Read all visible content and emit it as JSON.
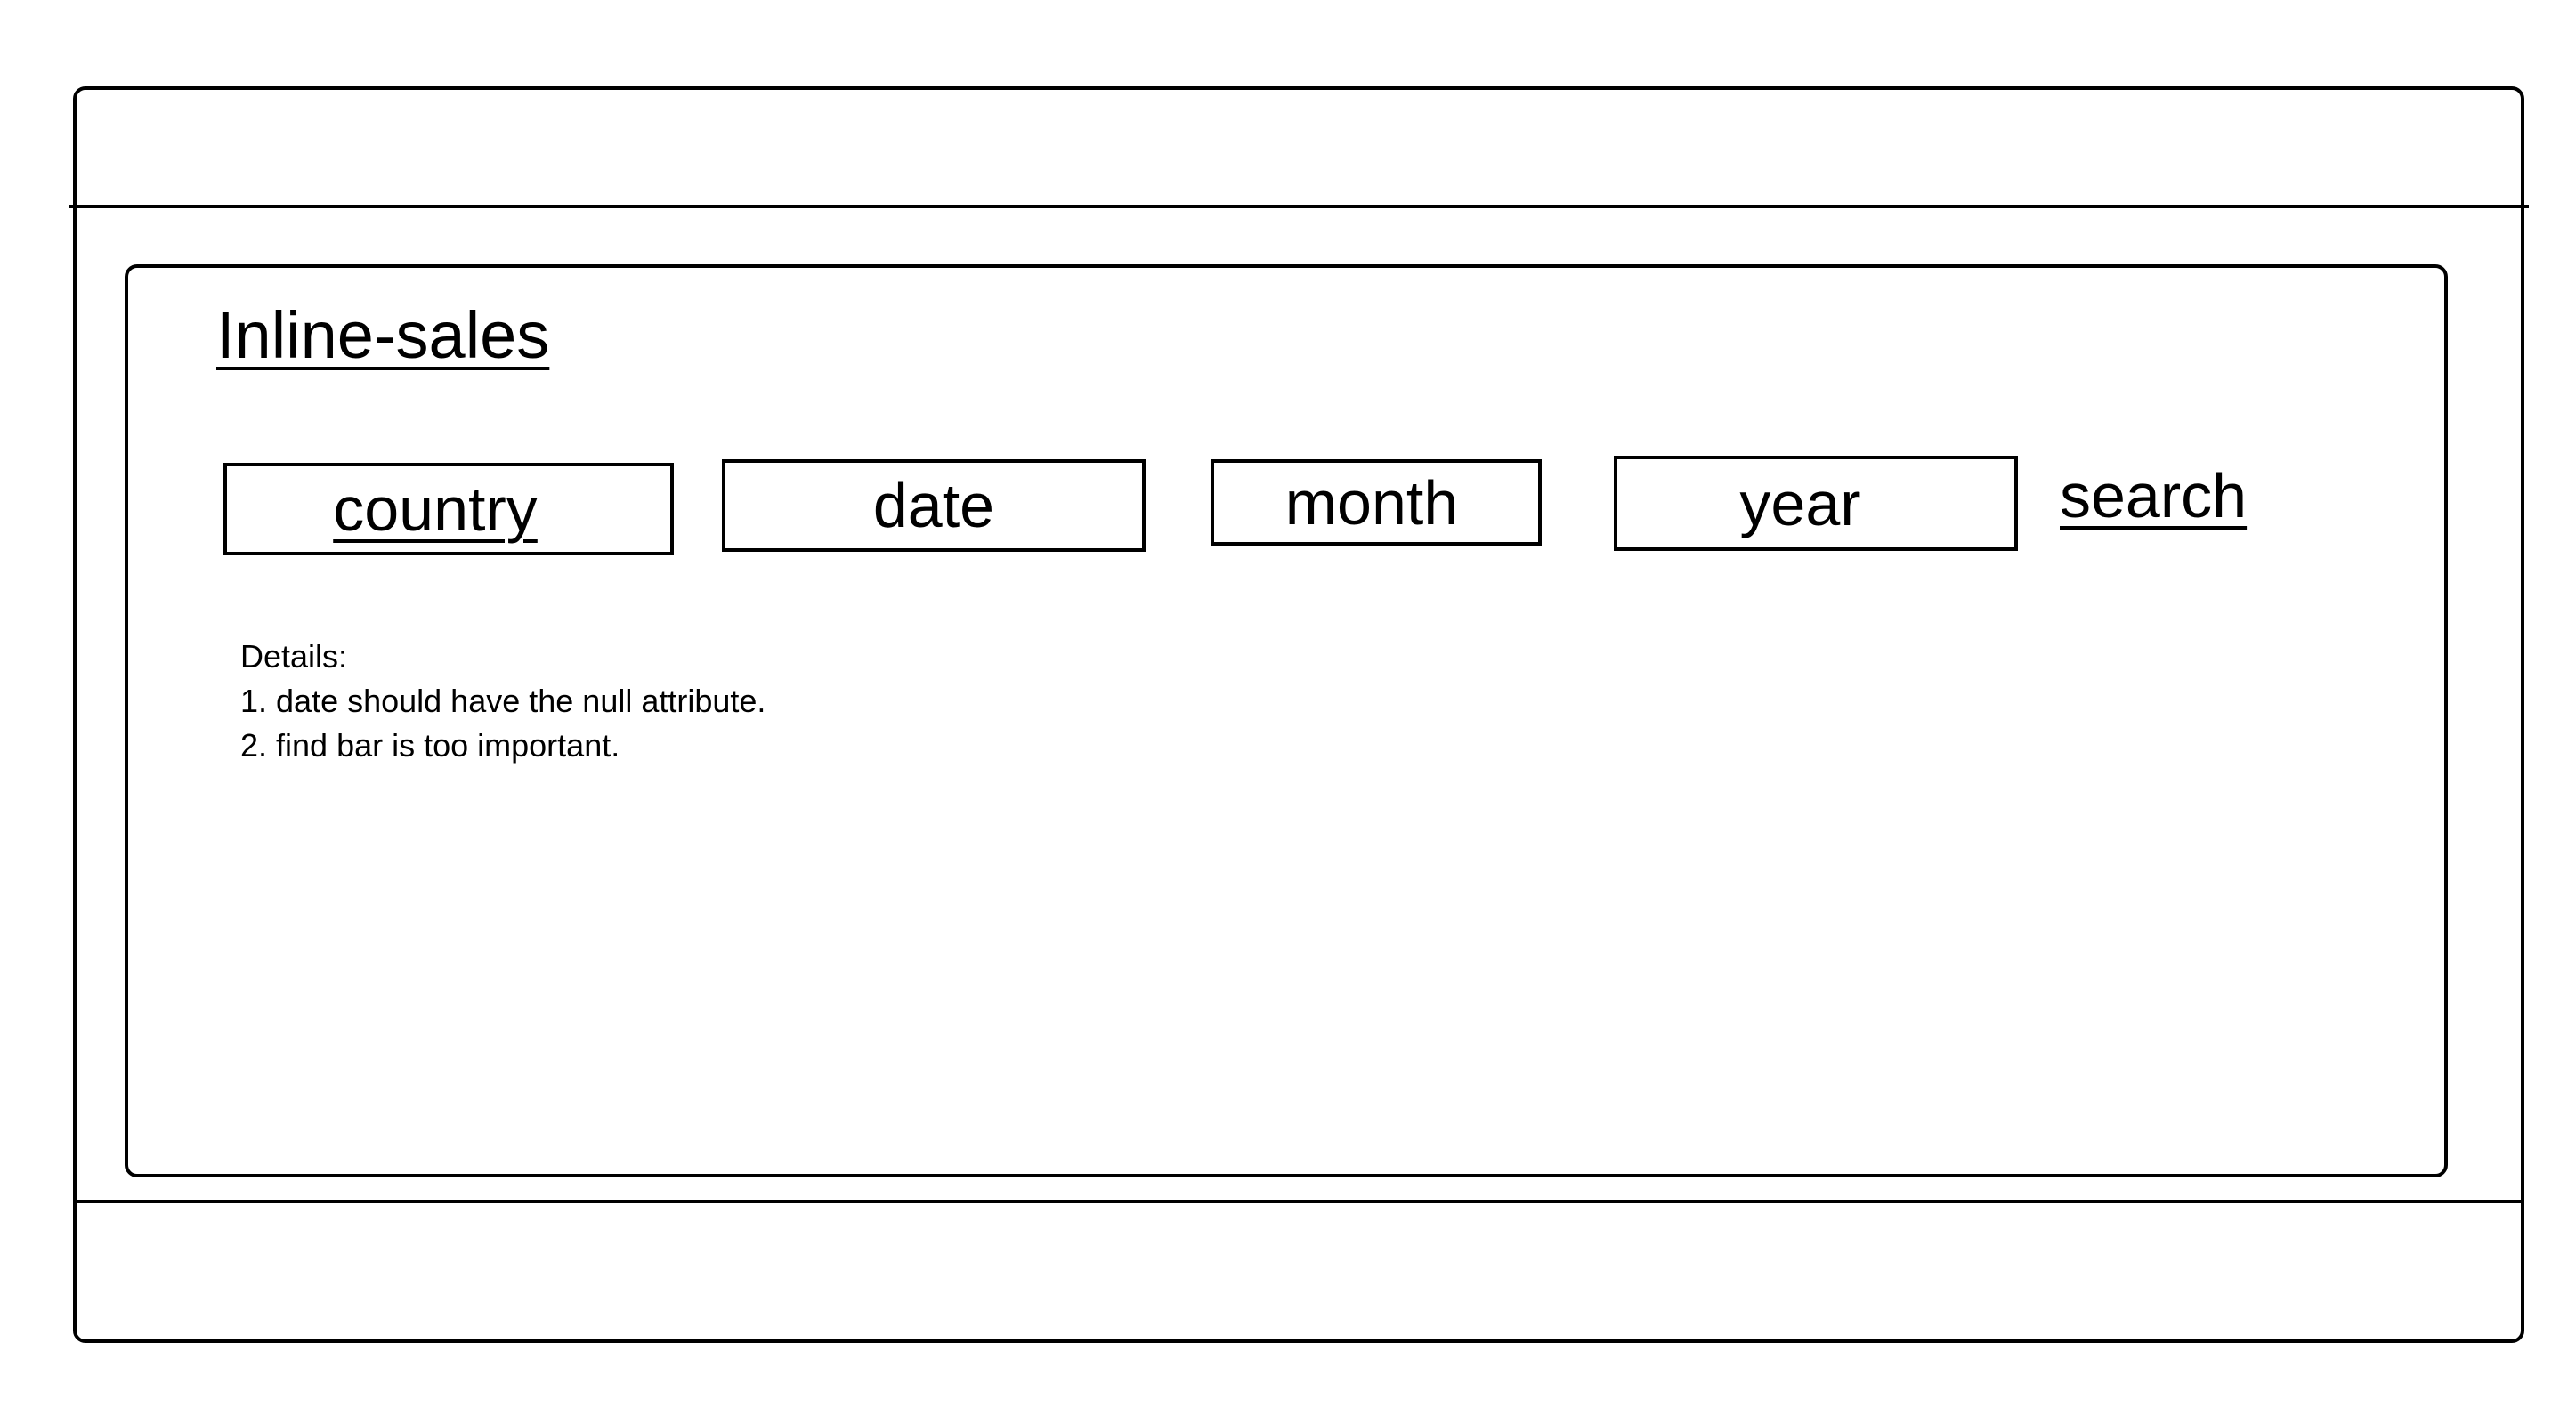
{
  "page": {
    "title": "Inline-sales"
  },
  "filters": {
    "country_label": "country",
    "date_label": "date",
    "month_label": "month",
    "year_label": "year"
  },
  "actions": {
    "search_label": "search"
  },
  "details": {
    "heading": "Details:",
    "items": [
      "1. date should have the null attribute.",
      "2. find bar is too important."
    ]
  }
}
